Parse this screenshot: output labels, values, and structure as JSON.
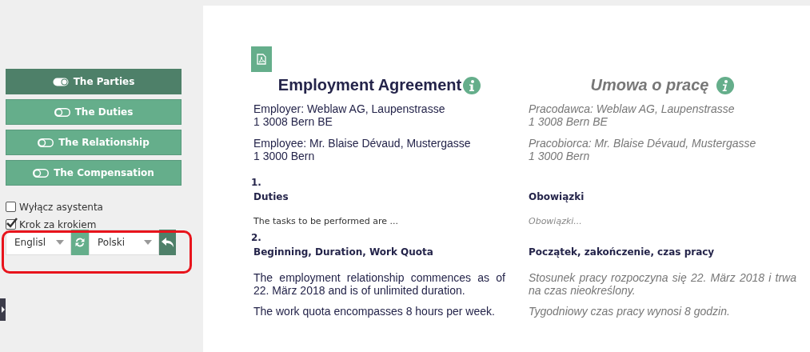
{
  "steps": [
    {
      "label": "The Parties",
      "selected": true
    },
    {
      "label": "The Duties",
      "selected": false
    },
    {
      "label": "The Relationship",
      "selected": false
    },
    {
      "label": "The Compensation",
      "selected": false
    }
  ],
  "options": [
    {
      "label": "Wyłącz asystenta",
      "checked": false
    },
    {
      "label": "Krok za krokiem",
      "checked": true
    }
  ],
  "languages": {
    "source": "Englisl",
    "target": "Polski"
  },
  "document": {
    "title_left": "Employment Agreement",
    "title_right": "Umowa o pracę",
    "parties": [
      {
        "left": "Employer: Weblaw AG, Laupenstrasse\n1 3008 Bern BE",
        "right": "Pracodawca: Weblaw AG, Laupenstrasse\n1 3008 Bern BE"
      },
      {
        "left": "Employee: Mr. Blaise Dévaud, Mustergasse\n1 3000 Bern",
        "right": "Pracobiorca: Mr. Blaise Dévaud, Mustergasse\n1 3000 Bern"
      }
    ],
    "sections": [
      {
        "number": "1.",
        "heading_left": "Duties",
        "heading_right": "Obowiązki",
        "paragraphs": [
          {
            "kind": "placeholder",
            "left": "The tasks to be performed are ...",
            "right": "Obowiązki..."
          }
        ]
      },
      {
        "number": "2.",
        "heading_left": "Beginning, Duration, Work Quota",
        "heading_right": "Początek, zakończenie, czas pracy",
        "paragraphs": [
          {
            "kind": "text",
            "left": "The employment relationship commences as of 22. März 2018 and is of unlimited duration.",
            "right": "Stosunek pracy rozpoczyna się 22. März 2018 i trwa na czas nieokreślony."
          },
          {
            "kind": "text",
            "left": "The work quota encompasses 8 hours per week.",
            "right": "Tygodniowy czas pracy wynosi 8 godzin."
          }
        ]
      }
    ]
  }
}
